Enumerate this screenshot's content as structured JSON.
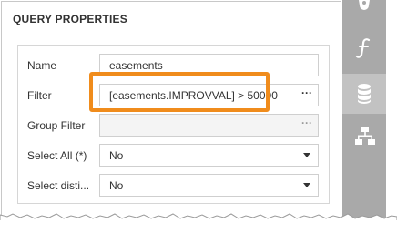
{
  "panel": {
    "title": "QUERY PROPERTIES"
  },
  "fields": {
    "name": {
      "label": "Name",
      "value": "easements"
    },
    "filter": {
      "label": "Filter",
      "value": "[easements.IMPROVVAL] > 50000",
      "button": "···"
    },
    "group_filter": {
      "label": "Group Filter",
      "value": "",
      "button": "···"
    },
    "select_all": {
      "label": "Select All (*)",
      "value": "No"
    },
    "select_distinct": {
      "label": "Select disti...",
      "value": "No"
    }
  },
  "sidebar": {
    "items": [
      {
        "icon": "gear-icon"
      },
      {
        "icon": "function-icon",
        "glyph": "f"
      },
      {
        "icon": "database-icon",
        "active": true
      },
      {
        "icon": "hierarchy-icon"
      }
    ]
  },
  "colors": {
    "highlight": "#f08c1c",
    "sidebar": "#a9a9a9",
    "sidebar_active": "#c2c2c2"
  }
}
